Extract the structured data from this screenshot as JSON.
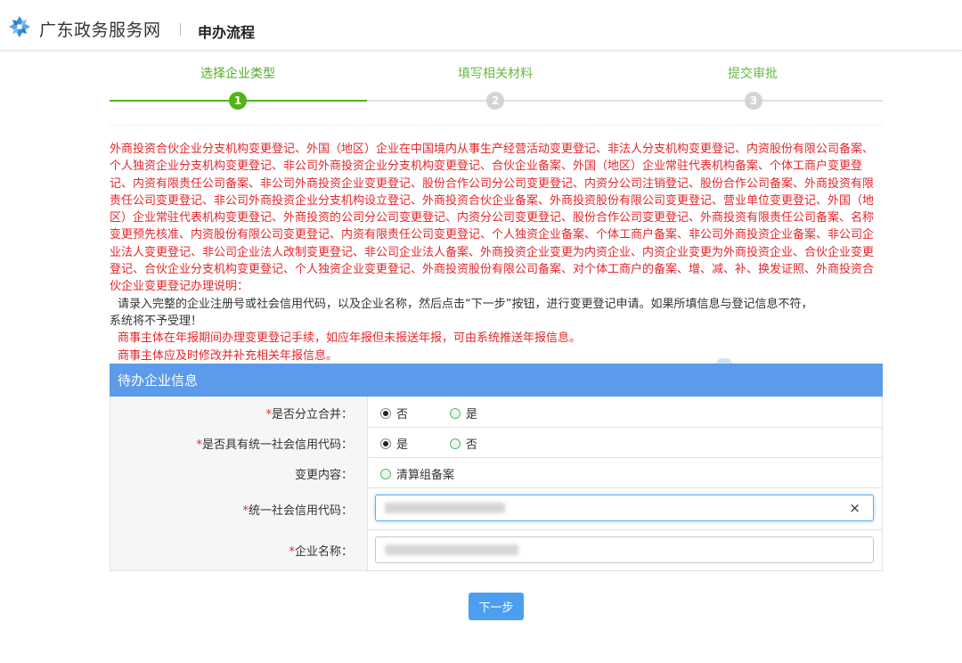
{
  "header": {
    "site_name": "广东政务服务网",
    "page_name": "申办流程"
  },
  "steps": [
    {
      "number": "1",
      "label": "选择企业类型",
      "state": "active"
    },
    {
      "number": "2",
      "label": "填写相关材料",
      "state": "pending"
    },
    {
      "number": "3",
      "label": "提交审批",
      "state": "pending"
    }
  ],
  "notice": {
    "types_text": "外商投资合伙企业分支机构变更登记、外国（地区）企业在中国境内从事生产经营活动变更登记、非法人分支机构变更登记、内资股份有限公司备案、个人独资企业分支机构变更登记、非公司外商投资企业分支机构变更登记、合伙企业备案、外国（地区）企业常驻代表机构备案、个体工商户变更登记、内资有限责任公司备案、非公司外商投资企业变更登记、股份合作公司分公司变更登记、内资分公司注销登记、股份合作公司备案、外商投资有限责任公司变更登记、非公司外商投资企业分支机构设立登记、外商投资合伙企业备案、外商投资股份有限公司变更登记、营业单位变更登记、外国（地区）企业常驻代表机构变更登记、外商投资的公司分公司变更登记、内资分公司变更登记、股份合作公司变更登记、外商投资有限责任公司备案、名称变更预先核准、内资股份有限公司变更登记、内资有限责任公司变更登记、个人独资企业备案、个体工商户备案、非公司外商投资企业备案、非公司企业法人变更登记、非公司企业法人改制变更登记、非公司企业法人备案、外商投资企业变更为内资企业、内资企业变更为外商投资企业、合伙企业变更登记、合伙企业分支机构变更登记、个人独资企业变更登记、外商投资股份有限公司备案、对个体工商户的备案、增、减、补、换发证照、外商投资合伙企业变更登记办理说明：",
    "instruction_line1": "请录入完整的企业注册号或社会信用代码，以及企业名称，然后点击“下一步”按钮，进行变更登记申请。如果所填信息与登记信息不符，",
    "instruction_line2": "系统将不予受理！",
    "warning_line1": "商事主体在年报期间办理变更登记手续，如应年报但未报送年报，可由系统推送年报信息。",
    "warning_line2": "商事主体应及时修改并补充相关年报信息。"
  },
  "form": {
    "title": "待办企业信息",
    "rows": [
      {
        "label": "是否分立合并：",
        "required": true,
        "options": [
          {
            "label": "否",
            "checked": true
          },
          {
            "label": "是",
            "checked": false
          }
        ]
      },
      {
        "label": "是否具有统一社会信用代码：",
        "required": true,
        "options": [
          {
            "label": "是",
            "checked": true
          },
          {
            "label": "否",
            "checked": false
          }
        ]
      },
      {
        "label": "变更内容：",
        "required": false,
        "options": [
          {
            "label": "清算组备案",
            "checked": false
          }
        ]
      },
      {
        "label": "统一社会信用代码：",
        "required": true,
        "value": ""
      },
      {
        "label": "企业名称：",
        "required": true,
        "value": ""
      }
    ],
    "required_mark": "*",
    "clear_symbol": "×"
  },
  "next_button": "下一步",
  "colors": {
    "accent_green": "#52b41a",
    "notice_red": "#e5262a",
    "form_header_blue": "#5b9bea",
    "button_blue": "#4c9ff0"
  },
  "icons": {
    "logo": "guangdong-logo-icon",
    "clear": "clear-icon"
  }
}
